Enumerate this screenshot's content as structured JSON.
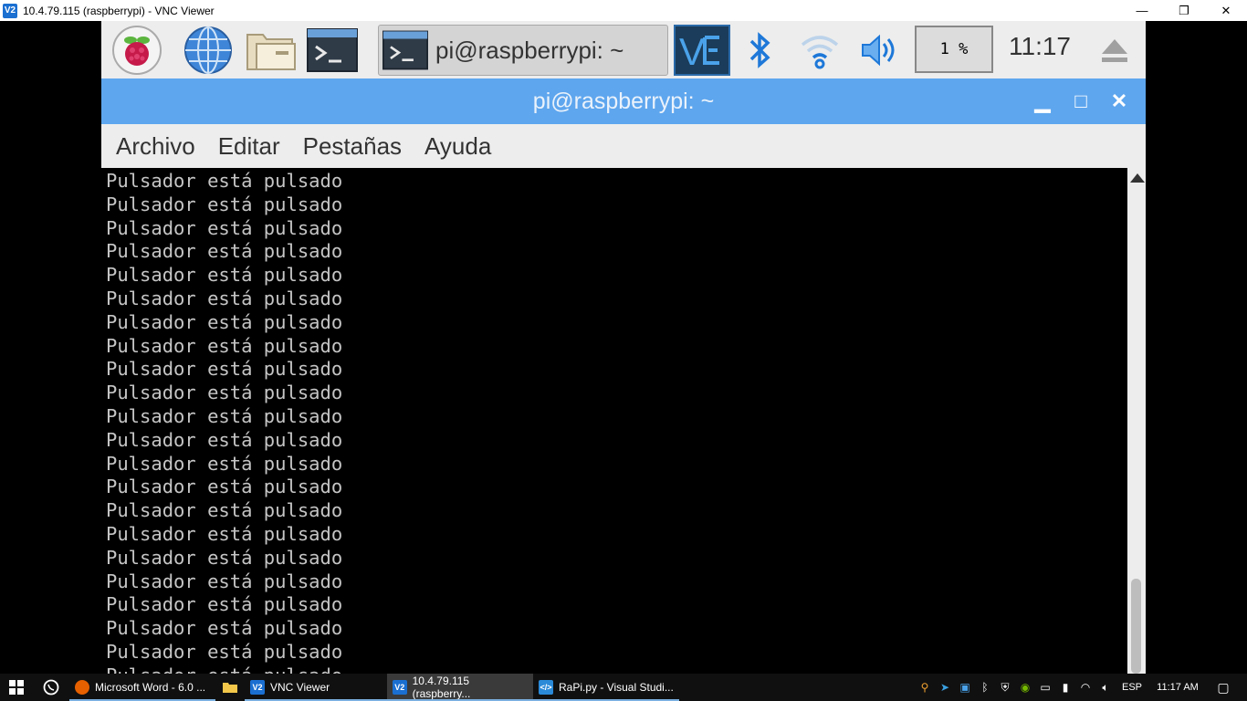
{
  "window": {
    "title": "10.4.79.115 (raspberrypi) - VNC Viewer",
    "icon_label": "V2",
    "minimize_glyph": "—",
    "maximize_glyph": "❐",
    "close_glyph": "✕"
  },
  "rpi_panel": {
    "task_button_label": "pi@raspberrypi: ~",
    "cpu_usage": "1 %",
    "clock": "11:17"
  },
  "terminal": {
    "title": "pi@raspberrypi: ~",
    "minimize_glyph": "▁",
    "maximize_glyph": "□",
    "close_glyph": "✕",
    "menu": [
      "Archivo",
      "Editar",
      "Pestañas",
      "Ayuda"
    ],
    "lines": [
      "Pulsador está pulsado",
      "Pulsador está pulsado",
      "Pulsador está pulsado",
      "Pulsador está pulsado",
      "Pulsador está pulsado",
      "Pulsador está pulsado",
      "Pulsador está pulsado",
      "Pulsador está pulsado",
      "Pulsador está pulsado",
      "Pulsador está pulsado",
      "Pulsador está pulsado",
      "Pulsador está pulsado",
      "Pulsador está pulsado",
      "Pulsador está pulsado",
      "Pulsador está pulsado",
      "Pulsador está pulsado",
      "Pulsador está pulsado",
      "Pulsador está pulsado",
      "Pulsador está pulsado",
      "Pulsador está pulsado",
      "Pulsador está pulsado",
      "Pulsador está pulsado"
    ]
  },
  "taskbar": {
    "apps": [
      {
        "label": "Microsoft Word - 6.0 ...",
        "icon": "firefox-icon",
        "color": "#e66000"
      },
      {
        "label": "VNC Viewer",
        "icon": "vnc-icon",
        "color": "#1a6fd1"
      },
      {
        "label": "10.4.79.115 (raspberry...",
        "icon": "vnc-icon",
        "color": "#1a6fd1"
      },
      {
        "label": "RaPi.py - Visual Studi...",
        "icon": "vscode-icon",
        "color": "#2a8ad8"
      }
    ],
    "language": "ESP",
    "time": "11:17 AM"
  }
}
